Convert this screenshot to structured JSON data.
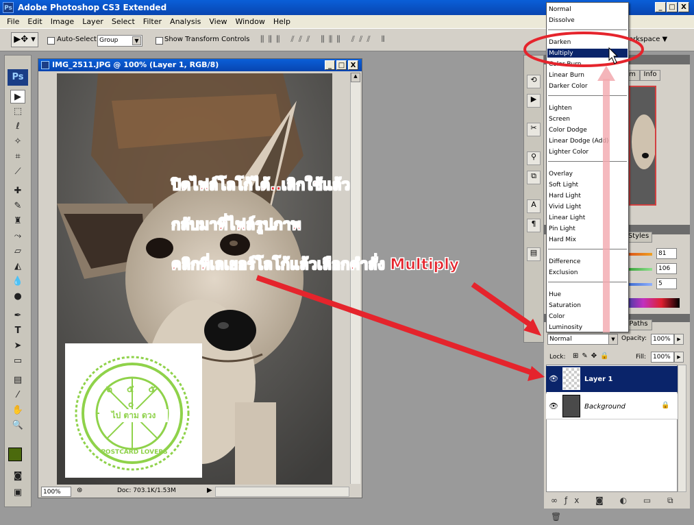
{
  "app": {
    "title": "Adobe Photoshop CS3 Extended",
    "ps_label": "Ps"
  },
  "window_controls": {
    "minimize": "_",
    "maximize": "□",
    "close": "X"
  },
  "menu": [
    "File",
    "Edit",
    "Image",
    "Layer",
    "Select",
    "Filter",
    "Analysis",
    "View",
    "Window",
    "Help"
  ],
  "options": {
    "auto_select_label": "Auto-Select:",
    "auto_select_value": "Group",
    "show_transform_label": "Show Transform Controls",
    "workspace_label": "orkspace ▼"
  },
  "document": {
    "title": "IMG_2511.JPG @ 100% (Layer 1, RGB/8)",
    "zoom": "100%",
    "doc_size": "Doc: 703.1K/1.53M"
  },
  "stamp": {
    "digits": "๒ ๕ ๕ ๐",
    "center_text": "ไป ตาม ดวง",
    "ring_text": "POSTCARD LOVERS"
  },
  "annotation": {
    "line1": "ปิดไฟล์โลโก้ได้..เลิกใช้แล้ว",
    "line2": "กลับมาที่ไฟล์รูปภาพ",
    "line3": "คลิกที่เลเยอร์โลโก้แล้วเลือกคำสั่ง Multiply"
  },
  "blend_modes": [
    "Normal",
    "Dissolve",
    "Darken",
    "Multiply",
    "Color Burn",
    "Linear Burn",
    "Darker Color",
    "Lighten",
    "Screen",
    "Color Dodge",
    "Linear Dodge (Add)",
    "Lighter Color",
    "Overlay",
    "Soft Light",
    "Hard Light",
    "Vivid Light",
    "Linear Light",
    "Pin Light",
    "Hard Mix",
    "Difference",
    "Exclusion",
    "Hue",
    "Saturation",
    "Color",
    "Luminosity"
  ],
  "selected_blend_mode": "Multiply",
  "navigator": {
    "tab_label": "m",
    "info_tab": "Info"
  },
  "color_panel": {
    "styles_tab": "Styles",
    "r": "81",
    "g": "106",
    "b": "5"
  },
  "layers_panel": {
    "paths_tab": "Paths",
    "blend_value": "Normal",
    "opacity_label": "Opacity:",
    "opacity_value": "100%",
    "lock_label": "Lock:",
    "fill_label": "Fill:",
    "fill_value": "100%",
    "layers": [
      {
        "name": "Layer 1",
        "selected": true
      },
      {
        "name": "Background",
        "selected": false
      }
    ]
  },
  "colors": {
    "accent": "#0a246a",
    "foreground": "#4b6a0d",
    "stamp": "#8fd24a",
    "annotation": "#e5242c"
  }
}
